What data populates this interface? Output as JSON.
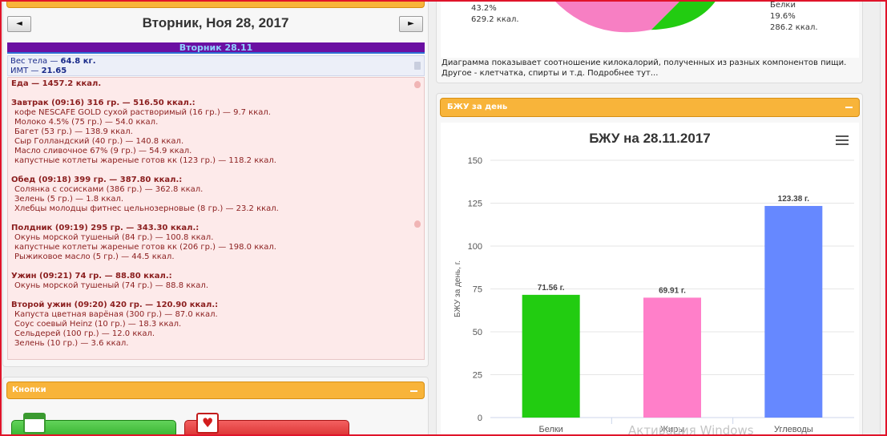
{
  "diary": {
    "date_title": "Вторник, Ноя 28, 2017",
    "prev_label": "◄",
    "next_label": "►",
    "day_header": "Вторник 28.11",
    "weight_label": "Вес тела — ",
    "weight_value": "64.8 кг.",
    "bmi_label": "ИМТ — ",
    "bmi_value": "21.65",
    "food_total": "Еда — 1457.2 ккал.",
    "meals": [
      {
        "title": "Завтрак (09:16) 316 гр. — 516.50 ккал.:",
        "items": [
          "кофе NESCAFE GOLD сухой растворимый (16 гр.) — 9.7 ккал.",
          "Молоко 4.5% (75 гр.) — 54.0 ккал.",
          "Багет (53 гр.) — 138.9 ккал.",
          "Сыр Голландский (40 гр.) — 140.8 ккал.",
          "Масло сливочное 67% (9 гр.) — 54.9 ккал.",
          "капустные котлеты жареные готов кк (123 гр.) — 118.2 ккал."
        ]
      },
      {
        "title": "Обед (09:18) 399 гр. — 387.80 ккал.:",
        "items": [
          "Солянка с сосисками (386 гр.) — 362.8 ккал.",
          "Зелень (5 гр.) — 1.8 ккал.",
          "Хлебцы молодцы фитнес цельнозерновые (8 гр.) — 23.2 ккал."
        ]
      },
      {
        "title": "Полдник (09:19) 295 гр. — 343.30 ккал.:",
        "items": [
          "Окунь морской тушеный (84 гр.) — 100.8 ккал.",
          "капустные котлеты жареные готов кк (206 гр.) — 198.0 ккал.",
          "Рыжиковое масло (5 гр.) — 44.5 ккал."
        ]
      },
      {
        "title": "Ужин (09:21) 74 гр. — 88.80 ккал.:",
        "items": [
          "Окунь морской тушеный (74 гр.) — 88.8 ккал."
        ]
      },
      {
        "title": "Второй ужин (09:20) 420 гр. — 120.90 ккал.:",
        "items": [
          "Капуста цветная варёная (300 гр.) — 87.0 ккал.",
          "Соус соевый Heinz (10 гр.) — 18.3 ккал.",
          "Сельдерей (100 гр.) — 12.0 ккал.",
          "Зелень (10 гр.) — 3.6 ккал."
        ]
      }
    ]
  },
  "buttons_panel": {
    "title": "Кнопки",
    "collapse_label": "−"
  },
  "pie_panel": {
    "left_percent": "43.2%",
    "left_kcal": "629.2 ккал.",
    "right_name": "Белки",
    "right_percent": "19.6%",
    "right_kcal": "286.2 ккал.",
    "description_line1": "Диаграмма показывает соотношение килокалорий, полученных из разных компонентов пищи.",
    "description_line2": "Другое - клетчатка, спирты и т.д. Подробнее тут...",
    "colors": {
      "pink": "#f77fc3",
      "green": "#22cc11"
    }
  },
  "bju_panel": {
    "header": "БЖУ за день",
    "collapse_label": "−"
  },
  "chart_data": {
    "type": "bar",
    "title": "БЖУ на 28.11.2017",
    "ylabel": "БЖУ за день, г.",
    "xlabel": "",
    "categories": [
      "Белки",
      "Жиры",
      "Углеводы"
    ],
    "values": [
      71.56,
      69.91,
      123.38
    ],
    "data_labels": [
      "71.56 г.",
      "69.91 г.",
      "123.38 г."
    ],
    "colors": [
      "#22cc11",
      "#ff7fc9",
      "#6688ff"
    ],
    "ylim": [
      0,
      150
    ],
    "yticks": [
      0,
      25,
      50,
      75,
      100,
      125,
      150
    ],
    "grid": true,
    "legend": "none"
  },
  "watermark": "Активация Windows"
}
